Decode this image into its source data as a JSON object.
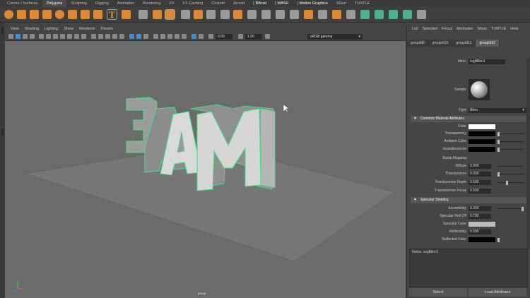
{
  "shelf": {
    "tabs": [
      "Curves / Surfaces",
      "Polygons",
      "Sculpting",
      "Rigging",
      "Animation",
      "Rendering",
      "FX",
      "FX Caching",
      "Custom",
      "Arnold",
      "Bifrost",
      "MASH",
      "Motion Graphics",
      "XGen",
      "TURTLE"
    ],
    "active_tab": "Polygons"
  },
  "viewport": {
    "menu": [
      "View",
      "Shading",
      "Lighting",
      "Show",
      "Renderer",
      "Panels"
    ],
    "near_value": "0.00",
    "far_value": "1.00",
    "color_space": "sRGB gamma",
    "camera_label": "persp",
    "scene_text": "3AM"
  },
  "attribute_editor": {
    "menu": [
      "List",
      "Selected",
      "Focus",
      "Attributes",
      "Show",
      "TURTLE",
      "Help"
    ],
    "node_tabs": [
      "groupId8",
      "groupId10",
      "groupId11",
      "groupId12"
    ],
    "active_node_tab": "groupId12",
    "material_label": "blinn:",
    "material_name": "svgBlinn1",
    "sample_label": "Sample",
    "type_label": "Type",
    "type_value": "Blinn",
    "section_common": "Common Material Attributes",
    "section_specular": "Specular Shading",
    "common": [
      {
        "label": "Color",
        "kind": "swatch",
        "color": "#ffffff"
      },
      {
        "label": "Transparency",
        "kind": "swatch",
        "color": "#000000"
      },
      {
        "label": "Ambient Color",
        "kind": "swatch",
        "color": "#000000"
      },
      {
        "label": "Incandescence",
        "kind": "swatch",
        "color": "#000000"
      },
      {
        "label": "Bump Mapping",
        "kind": "none"
      },
      {
        "label": "Diffuse",
        "kind": "value",
        "value": "0.800"
      },
      {
        "label": "Translucence",
        "kind": "value",
        "value": "0.000"
      },
      {
        "label": "Translucence Depth",
        "kind": "value",
        "value": "0.500"
      },
      {
        "label": "Translucence Focus",
        "kind": "value",
        "value": "0.500"
      }
    ],
    "specular": [
      {
        "label": "Eccentricity",
        "kind": "value",
        "value": "0.300"
      },
      {
        "label": "Specular Roll Off",
        "kind": "value",
        "value": "0.700"
      },
      {
        "label": "Specular Color",
        "kind": "swatch",
        "color": "#bdbdbd"
      },
      {
        "label": "Reflectivity",
        "kind": "value",
        "value": "0.500"
      },
      {
        "label": "Reflected Color",
        "kind": "swatch",
        "color": "#000000"
      }
    ],
    "notes_label": "Notes: svgBlinn1",
    "select_button": "Select",
    "load_attributes_button": "Load Attributes"
  }
}
